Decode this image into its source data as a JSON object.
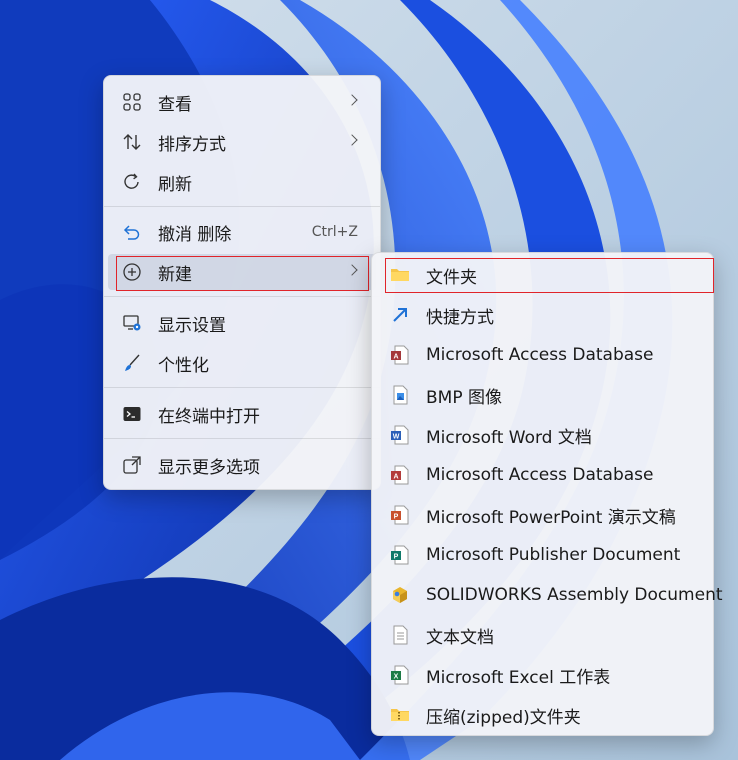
{
  "main_menu": {
    "items": [
      {
        "label": "查看",
        "icon": "grid-view-icon"
      },
      {
        "label": "排序方式",
        "icon": "sort-arrows-icon"
      },
      {
        "label": "刷新",
        "icon": "refresh-icon"
      },
      {
        "label": "撤消 删除",
        "icon": "undo-icon",
        "shortcut": "Ctrl+Z"
      },
      {
        "label": "新建",
        "icon": "plus-circle-icon"
      },
      {
        "label": "显示设置",
        "icon": "display-settings-icon"
      },
      {
        "label": "个性化",
        "icon": "brush-icon"
      },
      {
        "label": "在终端中打开",
        "icon": "terminal-icon"
      },
      {
        "label": "显示更多选项",
        "icon": "expand-icon"
      }
    ]
  },
  "submenu": {
    "items": [
      {
        "label": "文件夹",
        "icon": "folder-icon"
      },
      {
        "label": "快捷方式",
        "icon": "shortcut-arrow-icon"
      },
      {
        "label": "Microsoft Access Database",
        "icon": "access-file-icon"
      },
      {
        "label": "BMP 图像",
        "icon": "bmp-image-icon"
      },
      {
        "label": "Microsoft Word 文档",
        "icon": "word-file-icon"
      },
      {
        "label": "Microsoft Access Database",
        "icon": "access-file-icon"
      },
      {
        "label": "Microsoft PowerPoint 演示文稿",
        "icon": "powerpoint-file-icon"
      },
      {
        "label": "Microsoft Publisher Document",
        "icon": "publisher-file-icon"
      },
      {
        "label": "SOLIDWORKS Assembly Document",
        "icon": "solidworks-assembly-icon"
      },
      {
        "label": "文本文档",
        "icon": "text-file-icon"
      },
      {
        "label": "Microsoft Excel 工作表",
        "icon": "excel-file-icon"
      },
      {
        "label": "压缩(zipped)文件夹",
        "icon": "zip-folder-icon"
      }
    ]
  },
  "colors": {
    "highlight_box": "#e0242a",
    "accent": "#0067c0",
    "wallpaper_blue": "#1a4fd8"
  }
}
